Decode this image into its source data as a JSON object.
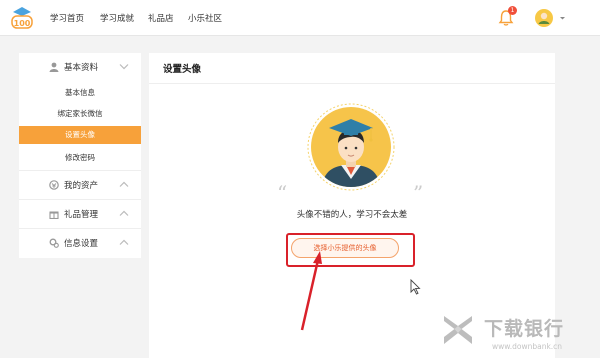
{
  "nav": {
    "logo_text": "100",
    "items": [
      {
        "label": "学习首页"
      },
      {
        "label": "学习成就"
      },
      {
        "label": "礼品店"
      },
      {
        "label": "小乐社区"
      }
    ],
    "bell_badge": "1"
  },
  "sidebar": {
    "groups": [
      {
        "label": "基本资料",
        "icon": "user-icon",
        "expanded": true
      },
      {
        "label": "我的资产",
        "icon": "asset-icon",
        "expanded": false
      },
      {
        "label": "礼品管理",
        "icon": "gift-icon",
        "expanded": false
      },
      {
        "label": "信息设置",
        "icon": "settings-icon",
        "expanded": false
      }
    ],
    "sub_items": [
      {
        "label": "基本信息",
        "active": false
      },
      {
        "label": "绑定家长微信",
        "active": false
      },
      {
        "label": "设置头像",
        "active": true
      },
      {
        "label": "修改密码",
        "active": false
      }
    ]
  },
  "main": {
    "title": "设置头像",
    "slogan": "头像不错的人，学习不会太差",
    "choose_button": "选择小乐提供的头像"
  },
  "watermark": {
    "title": "下载银行",
    "url": "www.downbank.cn"
  },
  "colors": {
    "accent_orange": "#f7a13a",
    "annotation_red": "#d9212a",
    "button_text": "#e65c2a"
  }
}
